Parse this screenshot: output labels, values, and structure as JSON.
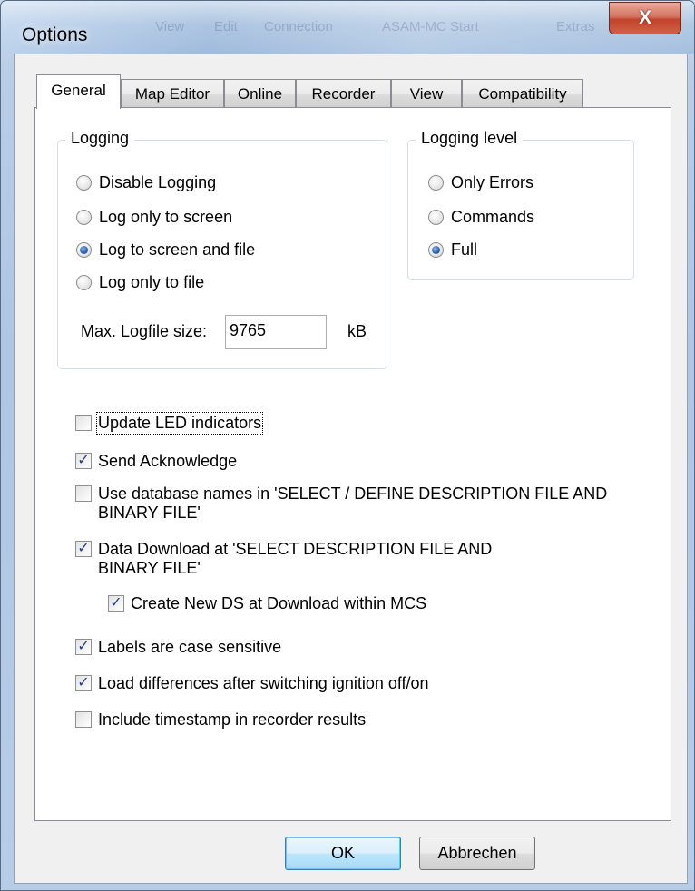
{
  "window": {
    "title": "Options",
    "close_label": "X",
    "ghost_menu": [
      "View",
      "Edit",
      "Connection",
      "ASAM-MC Start",
      "Extras"
    ]
  },
  "tabs": [
    {
      "label": "General"
    },
    {
      "label": "Map Editor"
    },
    {
      "label": "Online"
    },
    {
      "label": "Recorder"
    },
    {
      "label": "View"
    },
    {
      "label": "Compatibility"
    }
  ],
  "logging": {
    "legend": "Logging",
    "options": [
      {
        "label": "Disable Logging",
        "checked": false
      },
      {
        "label": "Log only to screen",
        "checked": false
      },
      {
        "label": "Log to screen and file",
        "checked": true
      },
      {
        "label": "Log only to file",
        "checked": false
      }
    ],
    "logfile_size_label": "Max. Logfile size:",
    "logfile_size_value": "9765",
    "logfile_size_unit": "kB"
  },
  "logging_level": {
    "legend": "Logging level",
    "options": [
      {
        "label": "Only Errors",
        "checked": false
      },
      {
        "label": "Commands",
        "checked": false
      },
      {
        "label": "Full",
        "checked": true
      }
    ]
  },
  "checkboxes": [
    {
      "label": "Update LED indicators",
      "checked": false
    },
    {
      "label": "Send Acknowledge",
      "checked": true
    },
    {
      "label": "Use database names in 'SELECT / DEFINE DESCRIPTION FILE AND BINARY FILE'",
      "checked": false
    },
    {
      "label": "Data Download at 'SELECT DESCRIPTION FILE AND BINARY FILE'",
      "checked": true
    },
    {
      "label": "Create New DS at Download within MCS",
      "checked": true
    },
    {
      "label": "Labels are case sensitive",
      "checked": true
    },
    {
      "label": "Load differences after switching ignition off/on",
      "checked": true
    },
    {
      "label": "Include timestamp in recorder results",
      "checked": false
    }
  ],
  "buttons": {
    "ok": "OK",
    "cancel": "Abbrechen"
  },
  "check_glyph": "✓"
}
